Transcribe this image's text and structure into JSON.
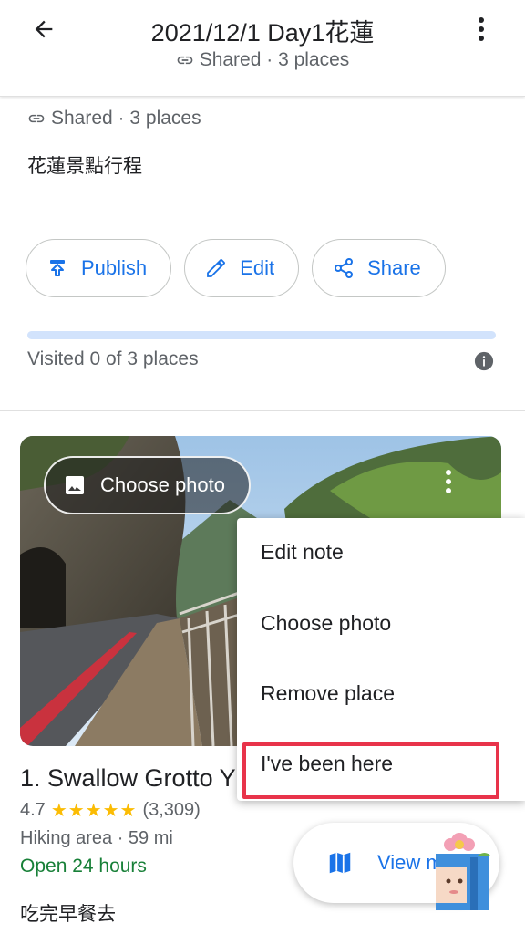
{
  "header": {
    "title": "2021/12/1 Day1花蓮",
    "subtitle": "Shared · 3 places",
    "back_icon": "arrow-back-icon",
    "more_icon": "more-vert-icon"
  },
  "info": {
    "meta": "Shared · 3 places",
    "description": "花蓮景點行程",
    "actions": [
      {
        "label": "Publish",
        "icon": "publish-icon"
      },
      {
        "label": "Edit",
        "icon": "pencil-icon"
      },
      {
        "label": "Share",
        "icon": "share-icon"
      }
    ],
    "progress_fraction": 0,
    "visited_text": "Visited 0 of 3 places"
  },
  "card": {
    "choose_photo_label": "Choose photo",
    "place_title": "1. Swallow Grotto Y",
    "rating": "4.7",
    "stars": "★★★★★",
    "review_count": "(3,309)",
    "category": "Hiking area · 59 mi",
    "hours": "Open 24 hours",
    "note": "吃完早餐去",
    "view_map_label": "View m"
  },
  "menu": {
    "items": [
      "Edit note",
      "Choose photo",
      "Remove place",
      "I've been here"
    ]
  },
  "colors": {
    "accent": "#1a73e8",
    "open_green": "#188038",
    "star": "#fbbc04",
    "highlight": "#e8334a"
  }
}
